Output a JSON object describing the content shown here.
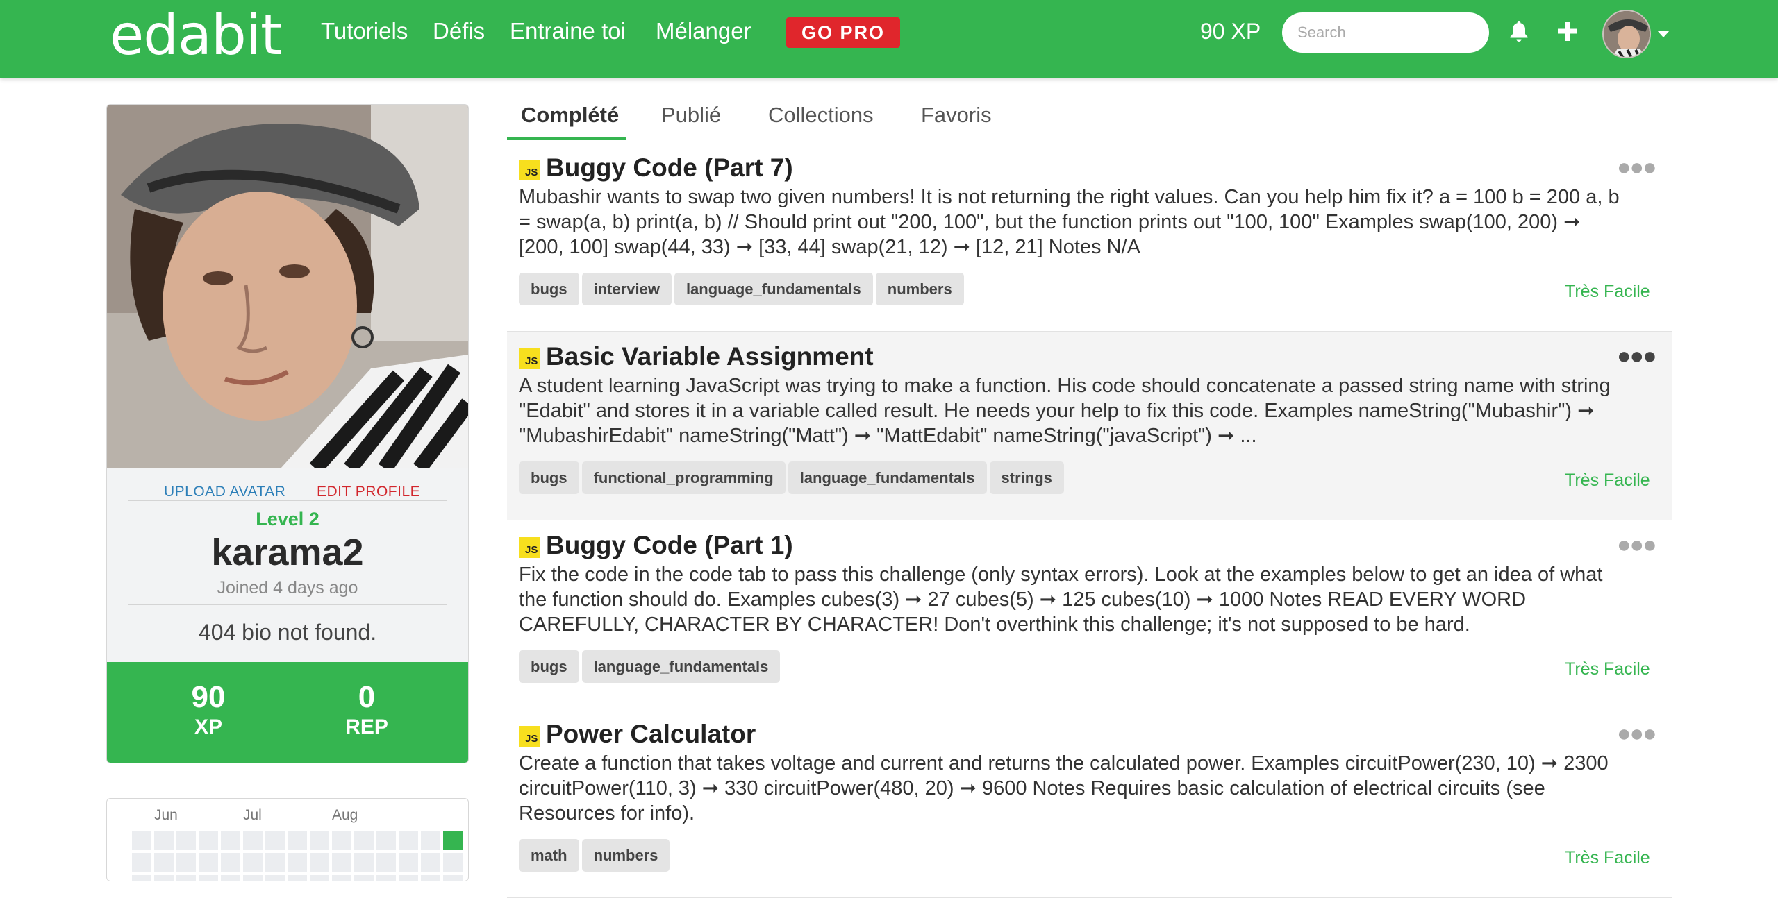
{
  "navbar": {
    "logo": "edabit",
    "links": [
      "Tutoriels",
      "Défis",
      "Entraine toi",
      "Mélanger"
    ],
    "go_pro": "GO PRO",
    "xp": "90 XP",
    "search_placeholder": "Search",
    "icons": [
      "bell-icon",
      "plus-icon",
      "avatar",
      "caret-down-icon"
    ]
  },
  "profile": {
    "upload_avatar": "UPLOAD AVATAR",
    "edit_profile": "EDIT PROFILE",
    "level": "Level 2",
    "username": "karama2",
    "joined": "Joined 4 days ago",
    "bio": "404 bio not found.",
    "stats": [
      {
        "value": "90",
        "label": "XP"
      },
      {
        "value": "0",
        "label": "REP"
      }
    ]
  },
  "activity": {
    "months": [
      "Jun",
      "Jul",
      "Aug"
    ]
  },
  "tabs": [
    "Complété",
    "Publié",
    "Collections",
    "Favoris"
  ],
  "active_tab": "Complété",
  "challenges": [
    {
      "lang": "JS",
      "title": "Buggy Code (Part 7)",
      "description": "Mubashir wants to swap two given numbers! It is not returning the right values. Can you help him fix it? a = 100 b = 200 a, b = swap(a, b) print(a, b) // Should print out \"200, 100\", but the function prints out \"100, 100\" Examples swap(100, 200) ➞ [200, 100] swap(44, 33) ➞ [33, 44] swap(21, 12) ➞ [12, 21] Notes N/A",
      "tags": [
        "bugs",
        "interview",
        "language_fundamentals",
        "numbers"
      ],
      "difficulty": "Très Facile"
    },
    {
      "lang": "JS",
      "title": "Basic Variable Assignment",
      "description": "A student learning JavaScript was trying to make a function. His code should concatenate a passed string name with string \"Edabit\" and stores it in a variable called result. He needs your help to fix this code. Examples nameString(\"Mubashir\") ➞ \"MubashirEdabit\" nameString(\"Matt\") ➞ \"MattEdabit\" nameString(\"javaScript\") ➞ ...",
      "tags": [
        "bugs",
        "functional_programming",
        "language_fundamentals",
        "strings"
      ],
      "difficulty": "Très Facile"
    },
    {
      "lang": "JS",
      "title": "Buggy Code (Part 1)",
      "description": "Fix the code in the code tab to pass this challenge (only syntax errors). Look at the examples below to get an idea of what the function should do. Examples cubes(3) ➞ 27 cubes(5) ➞ 125 cubes(10) ➞ 1000 Notes READ EVERY WORD CAREFULLY, CHARACTER BY CHARACTER! Don't overthink this challenge; it's not supposed to be hard.",
      "tags": [
        "bugs",
        "language_fundamentals"
      ],
      "difficulty": "Très Facile"
    },
    {
      "lang": "JS",
      "title": "Power Calculator",
      "description": "Create a function that takes voltage and current and returns the calculated power. Examples circuitPower(230, 10) ➞ 2300 circuitPower(110, 3) ➞ 330 circuitPower(480, 20) ➞ 9600 Notes Requires basic calculation of electrical circuits (see Resources for info).",
      "tags": [
        "math",
        "numbers"
      ],
      "difficulty": "Très Facile"
    }
  ],
  "colors": {
    "brand_green": "#35b550",
    "go_pro_red": "#e0262c",
    "link_blue": "#2d7fb8",
    "js_yellow": "#f7df1e"
  }
}
